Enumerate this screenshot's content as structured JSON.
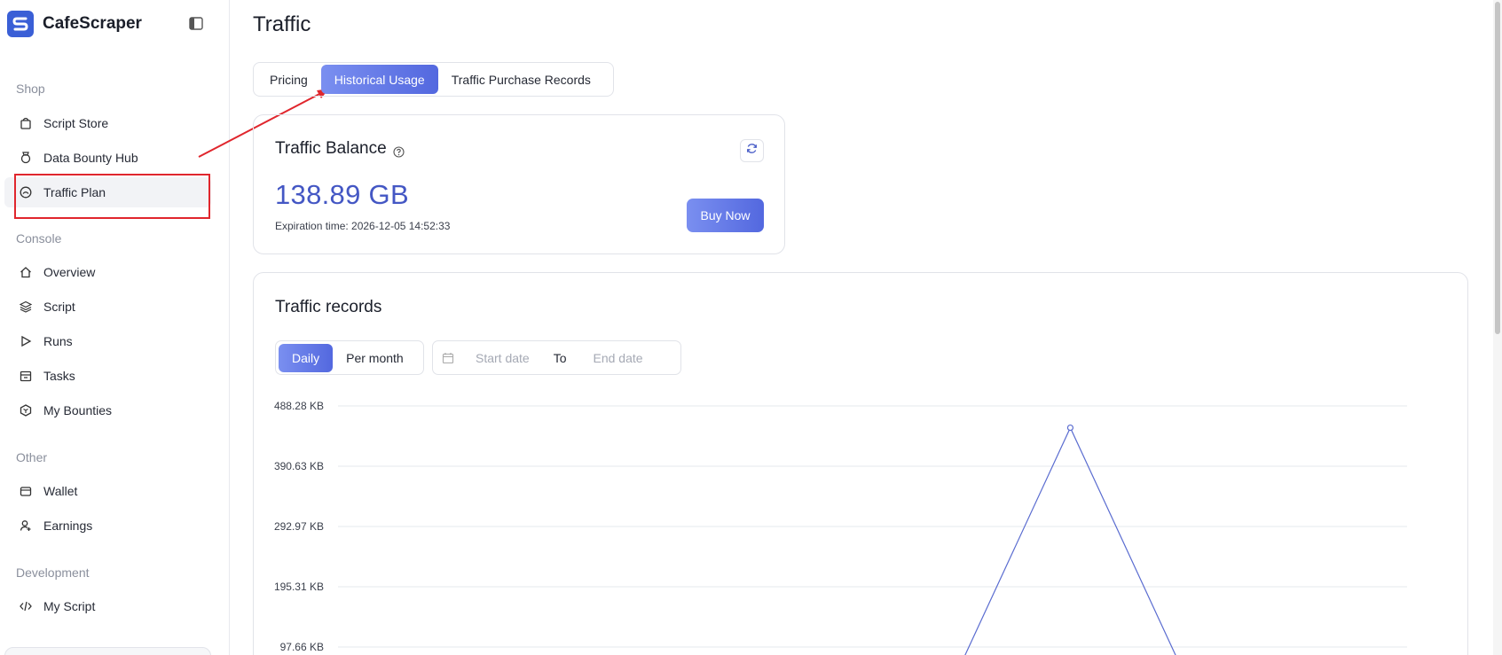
{
  "app": {
    "name": "CafeScraper"
  },
  "sidebar": {
    "sections": [
      {
        "label": "Shop",
        "items": [
          {
            "label": "Script Store",
            "icon": "bag-icon"
          },
          {
            "label": "Data Bounty Hub",
            "icon": "badge-icon"
          },
          {
            "label": "Traffic Plan",
            "icon": "gauge-icon",
            "active": true
          }
        ]
      },
      {
        "label": "Console",
        "items": [
          {
            "label": "Overview",
            "icon": "home-icon"
          },
          {
            "label": "Script",
            "icon": "layers-icon"
          },
          {
            "label": "Runs",
            "icon": "play-icon"
          },
          {
            "label": "Tasks",
            "icon": "calendar-icon"
          },
          {
            "label": "My Bounties",
            "icon": "hexagon-icon"
          }
        ]
      },
      {
        "label": "Other",
        "items": [
          {
            "label": "Wallet",
            "icon": "wallet-icon"
          },
          {
            "label": "Earnings",
            "icon": "user-plus-icon"
          }
        ]
      },
      {
        "label": "Development",
        "items": [
          {
            "label": "My Script",
            "icon": "code-icon"
          }
        ]
      }
    ]
  },
  "page": {
    "title": "Traffic",
    "tabs": [
      {
        "label": "Pricing",
        "active": false
      },
      {
        "label": "Historical Usage",
        "active": true
      },
      {
        "label": "Traffic Purchase Records",
        "active": false
      }
    ]
  },
  "balance": {
    "title": "Traffic Balance",
    "amount": "138.89 GB",
    "expiration": "Expiration time: 2026-12-05 14:52:33",
    "buy_label": "Buy Now"
  },
  "records": {
    "title": "Traffic records",
    "periods": [
      {
        "label": "Daily",
        "active": true
      },
      {
        "label": "Per month",
        "active": false
      }
    ],
    "date_range": {
      "start_placeholder": "Start date",
      "to_label": "To",
      "end_placeholder": "End date"
    }
  },
  "colors": {
    "accent": "#5368df",
    "balance_text": "#4457c4",
    "annotation": "#e0262d",
    "line": "#5a6cd0"
  },
  "chart_data": {
    "type": "line",
    "y_ticks": [
      "97.66 KB",
      "195.31 KB",
      "292.97 KB",
      "390.63 KB",
      "488.28 KB"
    ],
    "ylim": [
      0,
      500000
    ],
    "ylabel": "",
    "xlabel": "",
    "series": [
      {
        "values": [
          {
            "x": 0.58,
            "y": 60000
          },
          {
            "x": 0.685,
            "y": 453000
          },
          {
            "x": 0.79,
            "y": 60000
          }
        ]
      }
    ],
    "grid": true
  }
}
